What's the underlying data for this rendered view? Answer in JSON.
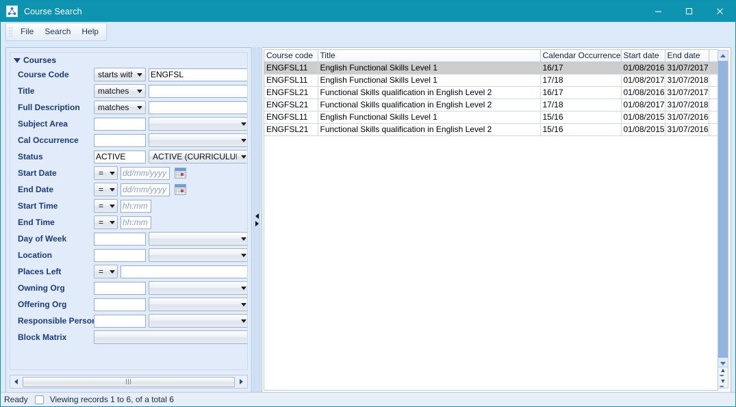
{
  "window": {
    "title": "Course Search",
    "icon": "network-graph-icon",
    "minimize_label": "Minimize",
    "maximize_label": "Maximize",
    "close_label": "Close",
    "titlebar_color": "#0e93b0"
  },
  "menubar": {
    "items": [
      {
        "label": "File",
        "name": "menu-file"
      },
      {
        "label": "Search",
        "name": "menu-search"
      },
      {
        "label": "Help",
        "name": "menu-help"
      }
    ]
  },
  "search_panel": {
    "section_title": "Courses",
    "fields": [
      {
        "label": "Course Code",
        "op": "starts with",
        "value": "ENGFSL",
        "type": "op-text"
      },
      {
        "label": "Title",
        "op": "matches",
        "value": "",
        "type": "op-text"
      },
      {
        "label": "Full Description",
        "op": "matches",
        "value": "",
        "type": "op-text"
      },
      {
        "label": "Subject Area",
        "value": "",
        "combo": "",
        "type": "text-combo"
      },
      {
        "label": "Cal Occurrence",
        "value": "",
        "combo": "",
        "type": "text-combo"
      },
      {
        "label": "Status",
        "value": "ACTIVE",
        "combo": "ACTIVE (CURRICULUM)",
        "type": "text-combo"
      },
      {
        "label": "Start Date",
        "op": "=",
        "placeholder": "dd/mm/yyyy",
        "value": "",
        "type": "date"
      },
      {
        "label": "End Date",
        "op": "=",
        "placeholder": "dd/mm/yyyy",
        "value": "",
        "type": "date"
      },
      {
        "label": "Start Time",
        "op": "=",
        "placeholder": "hh:mm",
        "value": "",
        "type": "time"
      },
      {
        "label": "End Time",
        "op": "=",
        "placeholder": "hh:mm",
        "value": "",
        "type": "time"
      },
      {
        "label": "Day of Week",
        "value": "",
        "combo": "",
        "type": "text-combo"
      },
      {
        "label": "Location",
        "value": "",
        "combo": "",
        "type": "text-combo"
      },
      {
        "label": "Places Left",
        "op": "=",
        "value": "",
        "type": "op-wide-text"
      },
      {
        "label": "Owning Org",
        "value": "",
        "combo": "",
        "type": "text-combo"
      },
      {
        "label": "Offering Org",
        "value": "",
        "combo": "",
        "type": "text-combo"
      },
      {
        "label": "Responsible Person",
        "value": "",
        "combo": "",
        "type": "text-combo"
      },
      {
        "label": "Block Matrix",
        "combo": "",
        "type": "wide-combo"
      }
    ]
  },
  "results": {
    "columns": [
      "Course code",
      "Title",
      "Calendar Occurrence",
      "Start date",
      "End date",
      ""
    ],
    "rows": [
      {
        "cells": [
          "ENGFSL11",
          "English Functional Skills Level 1",
          "16/17",
          "01/08/2016",
          "31/07/2017",
          ""
        ],
        "selected": true
      },
      {
        "cells": [
          "ENGFSL11",
          "English Functional Skills Level 1",
          "17/18",
          "01/08/2017",
          "31/07/2018",
          ""
        ],
        "selected": false
      },
      {
        "cells": [
          "ENGFSL21",
          "Functional Skills qualification in English Level 2",
          "16/17",
          "01/08/2016",
          "31/07/2017",
          ""
        ],
        "selected": false
      },
      {
        "cells": [
          "ENGFSL21",
          "Functional Skills qualification in English Level 2",
          "17/18",
          "01/08/2017",
          "31/07/2018",
          ""
        ],
        "selected": false
      },
      {
        "cells": [
          "ENGFSL11",
          "English Functional Skills Level 1",
          "15/16",
          "01/08/2015",
          "31/07/2016",
          ""
        ],
        "selected": false
      },
      {
        "cells": [
          "ENGFSL21",
          "Functional Skills qualification in English Level 2",
          "15/16",
          "01/08/2015",
          "31/07/2016",
          ""
        ],
        "selected": false
      }
    ]
  },
  "statusbar": {
    "state": "Ready",
    "records_text": "Viewing records 1 to 6, of a total 6"
  }
}
